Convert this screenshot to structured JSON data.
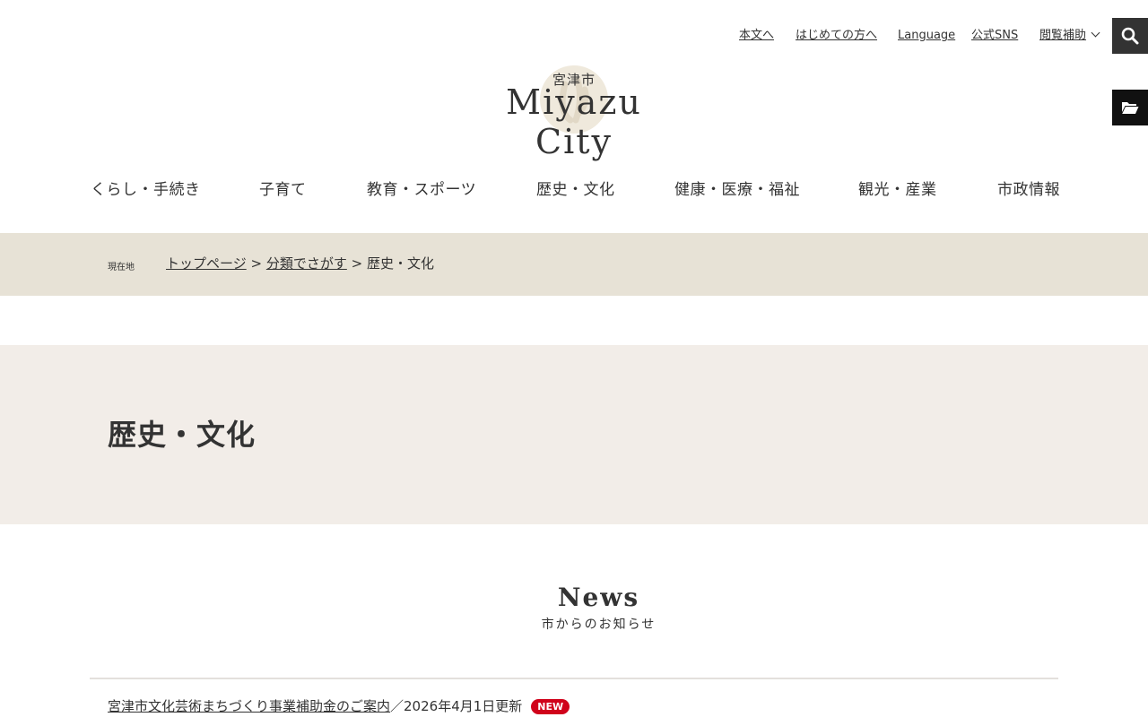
{
  "utility_nav": {
    "skip_to_content": "本文へ",
    "first_time": "はじめての方へ",
    "language": "Language",
    "official_sns": "公式SNS",
    "accessibility": "閲覧補助"
  },
  "logo": {
    "kanji": "宮津市",
    "english": "Miyazu City"
  },
  "global_nav": [
    "くらし・手続き",
    "子育て",
    "教育・スポーツ",
    "歴史・文化",
    "健康・医療・福祉",
    "観光・産業",
    "市政情報"
  ],
  "breadcrumb": {
    "label": "現在地",
    "items": [
      "トップページ",
      "分類でさがす"
    ],
    "current": "歴史・文化",
    "separator": ">"
  },
  "page_title": "歴史・文化",
  "news": {
    "heading": "News",
    "subheading": "市からのお知らせ",
    "items": [
      {
        "title": "宮津市文化芸術まちづくり事業補助金のご案内",
        "meta": "／2026年4月1日更新",
        "badge": "NEW"
      }
    ]
  },
  "colors": {
    "breadcrumb_bg": "#e7e2d6",
    "title_band_bg": "#f2ede8",
    "badge_red": "#d0021b",
    "dark_button": "#333333"
  },
  "icons": {
    "search": "search-icon",
    "folder": "folder-open-icon",
    "accessibility_chevron": "chevron-down-icon"
  }
}
